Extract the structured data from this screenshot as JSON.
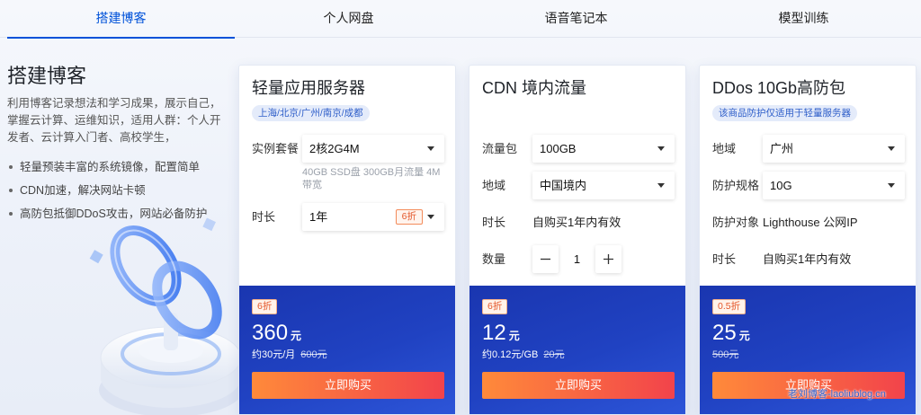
{
  "tabs": [
    {
      "label": "搭建博客",
      "active": true
    },
    {
      "label": "个人网盘",
      "active": false
    },
    {
      "label": "语音笔记本",
      "active": false
    },
    {
      "label": "模型训练",
      "active": false
    }
  ],
  "intro": {
    "title": "搭建博客",
    "description": "利用博客记录想法和学习成果，展示自己，掌握云计算、运维知识，适用人群：个人开发者、云计算入门者、高校学生，",
    "bullets": [
      "轻量预装丰富的系统镜像，配置简单",
      "CDN加速，解决网站卡顿",
      "高防包抵御DDoS攻击，网站必备防护"
    ]
  },
  "cards": [
    {
      "title": "轻量应用服务器",
      "badge": "上海/北京/广州/南京/成都",
      "fields": [
        {
          "label": "实例套餐",
          "value": "2核2G4M",
          "hint": "40GB SSD盘 300GB月流量 4M带宽"
        },
        {
          "label": "时长",
          "value": "1年",
          "tag": "6折"
        }
      ],
      "discount": "6折",
      "price": "360",
      "price_unit": "元",
      "unit_price": "约30元/月",
      "original_price": "600元",
      "buy_label": "立即购买"
    },
    {
      "title": "CDN 境内流量",
      "fields": [
        {
          "label": "流量包",
          "value": "100GB"
        },
        {
          "label": "地域",
          "value": "中国境内"
        },
        {
          "label": "时长",
          "value": "自购买1年内有效"
        },
        {
          "label": "数量",
          "value": 1
        }
      ],
      "discount": "6折",
      "price": "12",
      "price_unit": "元",
      "unit_price": "约0.12元/GB",
      "original_price": "20元",
      "buy_label": "立即购买"
    },
    {
      "title": "DDos 10Gb高防包",
      "badge": "该商品防护仅适用于轻量服务器",
      "fields": [
        {
          "label": "地域",
          "value": "广州"
        },
        {
          "label": "防护规格",
          "value": "10G"
        },
        {
          "label": "防护对象",
          "value": "Lighthouse 公网IP"
        },
        {
          "label": "时长",
          "value": "自购买1年内有效"
        }
      ],
      "discount": "0.5折",
      "price": "25",
      "price_unit": "元",
      "original_price": "500元",
      "buy_label": "立即购买"
    }
  ],
  "icons": {
    "select_caret": "caret-down-icon",
    "stepper_minus": "minus-icon",
    "stepper_plus": "plus-icon",
    "bullet": "bullet-dot-icon",
    "illustration": "infinity-platform-illustration"
  },
  "colors": {
    "accent": "#0052d9",
    "price_panel_start": "#1a36b0",
    "price_panel_end": "#2d55d8",
    "buy_button_start": "#ff8a3a",
    "buy_button_end": "#f2434b",
    "discount_tag": "#e4572a"
  },
  "watermark": "老刘博客-laoliublog.cn"
}
